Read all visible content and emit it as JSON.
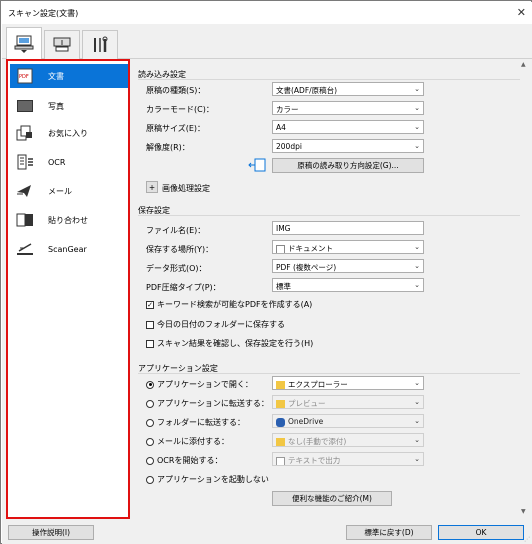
{
  "window": {
    "title": "スキャン設定(文書)",
    "close": "✕"
  },
  "sidebar": {
    "items": [
      {
        "label": "文書",
        "icon": "document-pdf-icon",
        "selected": true
      },
      {
        "label": "写真",
        "icon": "photo-icon",
        "selected": false
      },
      {
        "label": "お気に入り",
        "icon": "favorites-icon",
        "selected": false
      },
      {
        "label": "OCR",
        "icon": "ocr-icon",
        "selected": false
      },
      {
        "label": "メール",
        "icon": "mail-icon",
        "selected": false
      },
      {
        "label": "貼り合わせ",
        "icon": "stitch-icon",
        "selected": false
      },
      {
        "label": "ScanGear",
        "icon": "scangear-icon",
        "selected": false
      }
    ],
    "highlight_color": "#e01010",
    "selected_color": "#0a74d8"
  },
  "scan_options": {
    "heading": "読み込み設定",
    "source_label": "原稿の種類(S)：",
    "source_value": "文書(ADF/原稿台)",
    "color_label": "カラーモード(C)：",
    "color_value": "カラー",
    "size_label": "原稿サイズ(E)：",
    "size_value": "A4",
    "resolution_label": "解像度(R)：",
    "resolution_value": "200dpi",
    "orientation_button": "原稿の読み取り方向設定(G)...",
    "image_processing_toggle": "+",
    "image_processing_label": "画像処理設定"
  },
  "save_settings": {
    "heading": "保存設定",
    "filename_label": "ファイル名(E)：",
    "filename_value": "IMG",
    "location_label": "保存する場所(Y)：",
    "location_value": "ドキュメント",
    "format_label": "データ形式(O)：",
    "format_value": "PDF (複数ページ)",
    "compression_label": "PDF圧縮タイプ(P)：",
    "compression_value": "標準",
    "cb_keyword": "キーワード検索が可能なPDFを作成する(A)",
    "cb_keyword_checked": "✓",
    "cb_date_folder": "今日の日付のフォルダーに保存する",
    "cb_confirm": "スキャン結果を確認し、保存設定を行う(H)"
  },
  "app_settings": {
    "heading": "アプリケーション設定",
    "open_label": "アプリケーションで開く：",
    "open_value": "エクスプローラー",
    "send_label": "アプリケーションに転送する：",
    "send_value": "プレビュー",
    "folder_label": "フォルダーに転送する：",
    "folder_value": "OneDrive",
    "mail_label": "メールに添付する：",
    "mail_value": "なし(手動で添付)",
    "ocr_label": "OCRを開始する：",
    "ocr_value": "テキストで出力",
    "none_label": "アプリケーションを起動しない",
    "more_button": "便利な機能のご紹介(M)"
  },
  "footer": {
    "help_button": "操作説明(I)",
    "defaults_button": "標準に戻す(D)",
    "ok_button": "OK"
  }
}
